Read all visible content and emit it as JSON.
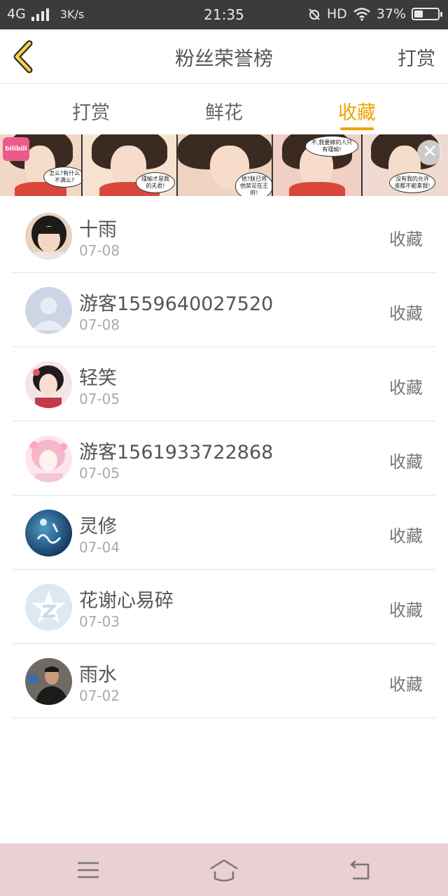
{
  "status_bar": {
    "network": "4G",
    "speed": "3K/s",
    "time": "21:35",
    "hd": "HD",
    "battery_percent": "37%",
    "battery_level": 0.37
  },
  "header": {
    "title": "粉丝荣誉榜",
    "action_label": "打赏",
    "back_icon": "chevron-left-icon"
  },
  "tabs": [
    {
      "label": "打赏",
      "active": false
    },
    {
      "label": "鲜花",
      "active": false
    },
    {
      "label": "收藏",
      "active": true
    }
  ],
  "banner": {
    "logo_text": "bilibili",
    "bubbles": [
      "怎么?有什么不满么?",
      "瑾瑜才是我的夫君!",
      "他?朕已将他禁足在王府!",
      "不,我要嫁的人只有瑾瑜!",
      "没有我的允许谁都不能拿我!"
    ],
    "close_icon": "close-icon"
  },
  "list": [
    {
      "name": "十雨",
      "date": "07-08",
      "action": "收藏",
      "avatar": "girl-photo"
    },
    {
      "name": "游客1559640027520",
      "date": "07-08",
      "action": "收藏",
      "avatar": "default-person"
    },
    {
      "name": "轻笑",
      "date": "07-05",
      "action": "收藏",
      "avatar": "anime-girl"
    },
    {
      "name": "游客1561933722868",
      "date": "07-05",
      "action": "收藏",
      "avatar": "anime-pink"
    },
    {
      "name": "灵修",
      "date": "07-04",
      "action": "收藏",
      "avatar": "blue-calligraphy"
    },
    {
      "name": "花谢心易碎",
      "date": "07-03",
      "action": "收藏",
      "avatar": "qzone-star"
    },
    {
      "name": "雨水",
      "date": "07-02",
      "action": "收藏",
      "avatar": "man-photo"
    }
  ],
  "bottom_nav": {
    "items": [
      "menu-icon",
      "home-icon",
      "back-icon"
    ]
  },
  "colors": {
    "accent": "#f0a300",
    "status_bar": "#3b3b3b",
    "bottom_nav": "#eacfd4"
  }
}
